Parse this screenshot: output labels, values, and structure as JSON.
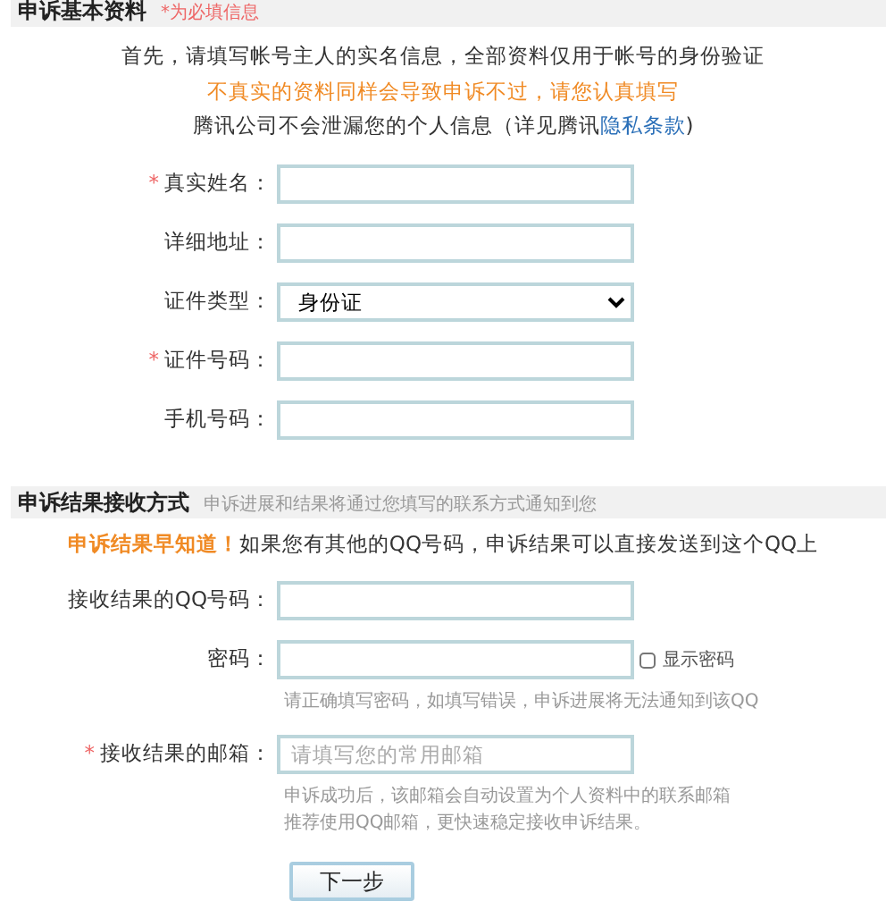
{
  "basic": {
    "title": "申诉基本资料",
    "note": "*为必填信息",
    "intro": [
      {
        "kind": "plain",
        "text": "首先，请填写帐号主人的实名信息，全部资料仅用于帐号的身份验证"
      },
      {
        "kind": "warning",
        "text": "不真实的资料同样会导致申诉不过，请您认真填写"
      },
      {
        "kind": "link",
        "text": "腾讯公司不会泄漏您的个人信息（详见腾讯",
        "link": "隐私条款",
        "after": ")"
      }
    ],
    "fields": [
      {
        "kind": "input",
        "required_mark": "*",
        "label": "真实姓名："
      },
      {
        "kind": "input",
        "label": "详细地址："
      },
      {
        "kind": "select",
        "label": "证件类型：",
        "value": "身份证"
      },
      {
        "kind": "input",
        "required_mark": "*",
        "label": "证件号码："
      },
      {
        "kind": "input",
        "label": "手机号码："
      }
    ]
  },
  "result": {
    "title": "申诉结果接收方式",
    "note": "申诉进展和结果将通过您填写的联系方式通知到您",
    "notice": {
      "highlight": "申诉结果早知道！",
      "text": "如果您有其他的QQ号码，申诉结果可以直接发送到这个QQ上"
    },
    "fields": [
      {
        "kind": "input",
        "label": "接收结果的QQ号码："
      },
      {
        "kind": "input",
        "label": "密码：",
        "checkbox": {
          "label": "显示密码",
          "checked": false
        },
        "hints": [
          "请正确填写密码，如填写错误，申诉进展将无法通知到该QQ"
        ]
      },
      {
        "kind": "input",
        "required_mark": "*",
        "label": "接收结果的邮箱：",
        "placeholder": "请填写您的常用邮箱",
        "hints": [
          "申诉成功后，该邮箱会自动设置为个人资料中的联系邮箱",
          "推荐使用QQ邮箱，更快速稳定接收申诉结果。"
        ]
      }
    ]
  },
  "next_button": "下一步"
}
